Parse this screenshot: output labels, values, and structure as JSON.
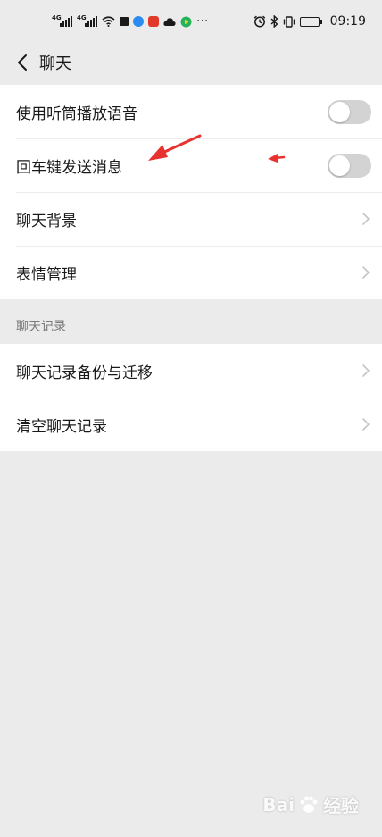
{
  "status_bar": {
    "network1": "4G",
    "network2": "4G",
    "time": "09:19",
    "icons": [
      "signal-icon",
      "signal-icon",
      "wifi-icon",
      "square-icon",
      "app-icon",
      "app-icon",
      "cloud-icon",
      "play-icon",
      "more-icon",
      "alarm-icon",
      "bluetooth-icon",
      "vibrate-icon",
      "battery-icon"
    ],
    "battery_level": 0.9
  },
  "nav": {
    "title": "聊天",
    "back_icon": "chevron-left-icon"
  },
  "settings": [
    {
      "label": "使用听筒播放语音",
      "control": "toggle",
      "on": false
    },
    {
      "label": "回车键发送消息",
      "control": "toggle",
      "on": false
    },
    {
      "label": "聊天背景",
      "control": "chevron"
    },
    {
      "label": "表情管理",
      "control": "chevron"
    }
  ],
  "history_section": {
    "header": "聊天记录",
    "items": [
      {
        "label": "聊天记录备份与迁移",
        "control": "chevron"
      },
      {
        "label": "清空聊天记录",
        "control": "chevron"
      }
    ]
  },
  "colors": {
    "background": "#ebebeb",
    "row_bg": "#ffffff",
    "toggle_off": "#d3d3d3",
    "annotation_arrow": "#e8322f"
  },
  "watermark": {
    "text": "Bai",
    "text2": "经验"
  }
}
